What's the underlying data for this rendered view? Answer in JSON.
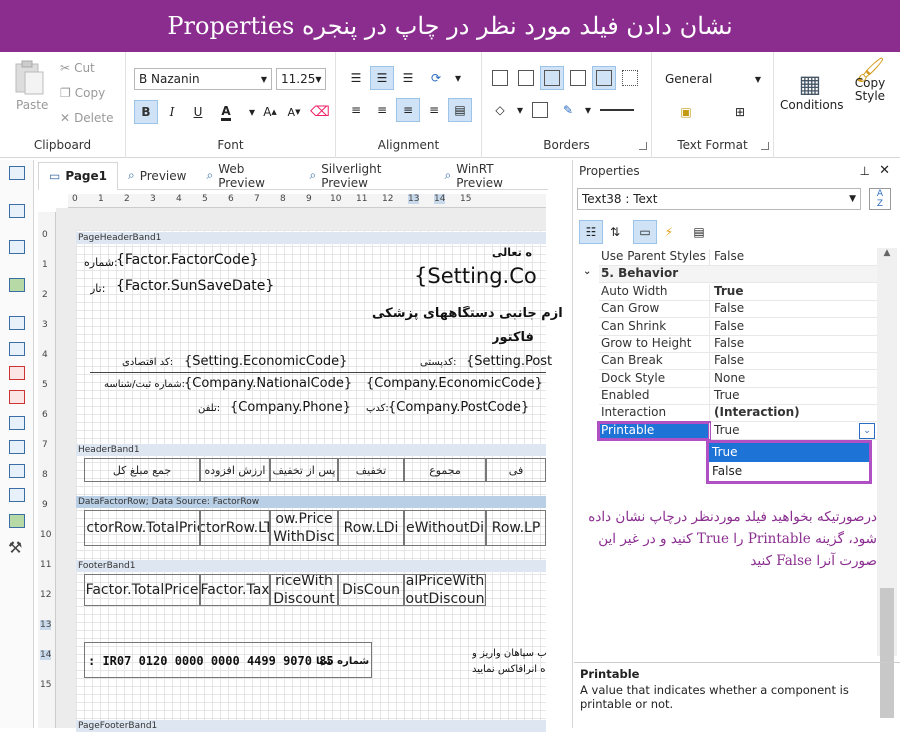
{
  "banner": {
    "title": "نشان دادن فیلد مورد نظر در چاپ در پنجره Properties"
  },
  "ribbon": {
    "clipboard": {
      "paste": "Paste",
      "cut": "Cut",
      "copy": "Copy",
      "delete": "Delete",
      "label": "Clipboard"
    },
    "font": {
      "family": "B Nazanin",
      "size": "11.25",
      "label": "Font"
    },
    "alignment": {
      "label": "Alignment"
    },
    "borders": {
      "label": "Borders"
    },
    "text_format": {
      "format": "General",
      "label": "Text Format"
    },
    "conditions": "Conditions",
    "copy_style": "Copy Style"
  },
  "tabs": [
    {
      "label": "Page1"
    },
    {
      "label": "Preview"
    },
    {
      "label": "Web Preview"
    },
    {
      "label": "Silverlight Preview"
    },
    {
      "label": "WinRT Preview"
    }
  ],
  "ruler": {
    "h": [
      "0",
      "1",
      "2",
      "3",
      "4",
      "5",
      "6",
      "7",
      "8",
      "9",
      "10",
      "11",
      "12",
      "13",
      "14",
      "15"
    ],
    "v": [
      "0",
      "1",
      "2",
      "3",
      "4",
      "5",
      "6",
      "7",
      "8",
      "9",
      "10",
      "11",
      "12",
      "13",
      "14",
      "15"
    ]
  },
  "report": {
    "bands": {
      "page_header": "PageHeaderBand1",
      "header": "HeaderBand1",
      "data": "DataFactorRow; Data Source: FactorRow",
      "footer": "FooterBand1",
      "page_footer": "PageFooterBand1"
    },
    "fields": {
      "factor_code": "{Factor.FactorCode}",
      "factor_code_label": ":شماره",
      "sun_save_date": "{Factor.SunSaveDate}",
      "sun_save_label": ":تار",
      "title_top": "ه تعالی",
      "setting_co": "{Setting.Co",
      "subtitle1": "ازم جانبی دستگاههای پزشکی",
      "subtitle2": "فاکتور",
      "economic_code": "{Setting.EconomicCode}",
      "economic_label": ":کد اقتصادی",
      "setting_post": "{Setting.Post",
      "post_label": ":کدپستی",
      "national_code": "{Company.NationalCode}",
      "national_label": ":شماره ثبت/شناسه",
      "company_economic": "{Company.EconomicCode}",
      "company_phone": "{Company.Phone}",
      "phone_label": ":تلفن",
      "company_post": "{Company.PostCode}",
      "company_post_label": ":کدپ"
    },
    "header_cells": [
      "جمع مبلغ کل",
      "ارزش افزوده",
      "پس از تخفیف",
      "تخفیف",
      "مجموع",
      "فی"
    ],
    "data_cells": [
      "{FactorRow.TotalPrice}",
      "{FactorRow.LTax}",
      "ow.Price WithDisc",
      "Row.LDi",
      "eWithoutDi",
      "Row.LP"
    ],
    "footer_cells": [
      "{Factor.TotalPrice}",
      "{Factor.Tax}",
      "riceWith Discount",
      "DisCoun",
      "alPriceWith outDiscoun"
    ],
    "sheba_label": "شماره شبا",
    "sheba": ": IR07 0120 0000 0000 4499 9070 85",
    "footer_note1": "ب سپاهان واریز و",
    "footer_note2": "ه آنرافاکس نمایید"
  },
  "properties": {
    "title": "Properties",
    "component": "Text38 : Text",
    "rows": [
      {
        "k": "Use Parent Styles",
        "v": "False"
      },
      {
        "k": "5. Behavior",
        "v": ""
      },
      {
        "k": "Auto Width",
        "v": "True"
      },
      {
        "k": "Can Grow",
        "v": "False"
      },
      {
        "k": "Can Shrink",
        "v": "False"
      },
      {
        "k": "Grow to Height",
        "v": "False"
      },
      {
        "k": "Can Break",
        "v": "False"
      },
      {
        "k": "Dock Style",
        "v": "None"
      },
      {
        "k": "Enabled",
        "v": "True"
      },
      {
        "k": "Interaction",
        "v": "(Interaction)"
      },
      {
        "k": "Printable",
        "v": "True"
      }
    ],
    "dropdown": [
      "True",
      "False"
    ],
    "note": "درصورتیکه بخواهید فیلد موردنظر درچاپ نشان داده شود، گزینه Printable را True کنید  و در غیر این صورت آنرا False کنید",
    "desc_title": "Printable",
    "desc_text": "A value that indicates whether a component is printable or not."
  },
  "colors": {
    "banner": "#8a2d8f",
    "highlight": "#b14fc5",
    "selection": "#1e74d6"
  }
}
